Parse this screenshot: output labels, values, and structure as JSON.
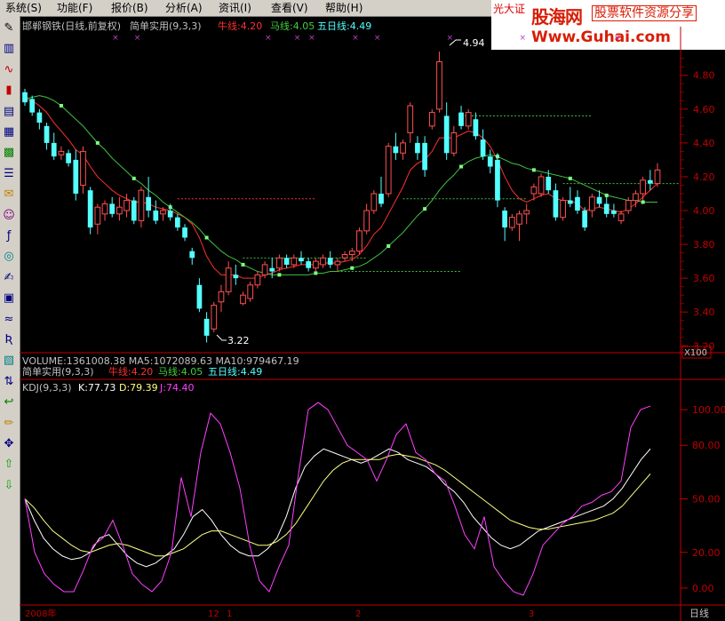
{
  "menu": [
    "系统(S)",
    "功能(F)",
    "报价(B)",
    "分析(A)",
    "资讯(I)",
    "查看(V)",
    "帮助(H)"
  ],
  "brand": {
    "broker": "光大证",
    "main": "股海网",
    "sub": "股票软件资源分享",
    "url": "Www.Guhai.com"
  },
  "toolbar_icons": [
    "drawing-icon",
    "bar-chart-icon",
    "line-chart-icon",
    "candlestick-icon",
    "report-icon",
    "table-icon",
    "grid-icon",
    "stock-list-icon",
    "mail-icon",
    "people-icon",
    "formula-icon",
    "news-icon",
    "notes-icon",
    "text-f10-icon",
    "indicator-icon",
    "rsi-icon",
    "system-icon",
    "sort-icon",
    "back-icon",
    "pencil-icon",
    "move-icon",
    "up-arrow-icon",
    "down-arrow-icon"
  ],
  "main_header": {
    "title": "邯郸钢铁(日线,前复权)",
    "indicator": "简单实用(9,3,3)",
    "niu": "牛线:4.20",
    "ma": "马线:4.05",
    "wu": "五日线:4.49"
  },
  "volume_header": "VOLUME:1361008.38  MA5:1072089.63  MA10:979467.19",
  "sub_header": {
    "indicator": "简单实用(9,3,3)",
    "niu": "牛线:4.20",
    "ma": "马线:4.05",
    "wu": "五日线:4.49"
  },
  "kdj_header": {
    "name": "KDJ(9,3,3)",
    "k": "K:77.73",
    "d": "D:79.39",
    "j": "J:74.40"
  },
  "annotations": {
    "high": "4.94",
    "low": "3.22"
  },
  "axis_badge": "X100",
  "period_label": "日线",
  "date_labels": [
    "2008年",
    "12",
    "1",
    "2",
    "3"
  ],
  "colors": {
    "up": "#ff5050",
    "down": "#54ffff",
    "niu": "#ff3030",
    "ma": "#40c040",
    "five": "#ffffff",
    "k": "#ffffff",
    "d": "#ffff80",
    "j": "#ff40ff",
    "grid": "#800000"
  },
  "chart_data": [
    {
      "type": "candlestick",
      "title": "邯郸钢铁(日线,前复权)",
      "y_ticks": [
        "4.80",
        "4.60",
        "4.40",
        "4.20",
        "4.00",
        "3.80",
        "3.60",
        "3.40",
        "3.20"
      ],
      "ylim": [
        3.17,
        4.93
      ],
      "candles": [
        [
          4.7,
          4.72,
          4.62,
          4.64
        ],
        [
          4.66,
          4.68,
          4.56,
          4.58
        ],
        [
          4.58,
          4.6,
          4.48,
          4.52
        ],
        [
          4.5,
          4.52,
          4.36,
          4.4
        ],
        [
          4.4,
          4.46,
          4.3,
          4.32
        ],
        [
          4.33,
          4.38,
          4.3,
          4.35
        ],
        [
          4.34,
          4.36,
          4.26,
          4.28
        ],
        [
          4.3,
          4.36,
          4.06,
          4.1
        ],
        [
          4.15,
          4.38,
          4.1,
          4.35
        ],
        [
          4.12,
          4.14,
          3.86,
          3.9
        ],
        [
          3.92,
          4.04,
          3.86,
          4.02
        ],
        [
          3.98,
          4.06,
          3.94,
          4.04
        ],
        [
          4.04,
          4.08,
          3.96,
          3.98
        ],
        [
          3.98,
          4.08,
          3.94,
          4.02
        ],
        [
          4.0,
          4.1,
          3.96,
          4.06
        ],
        [
          4.06,
          4.08,
          3.92,
          3.94
        ],
        [
          3.94,
          4.14,
          3.9,
          4.12
        ],
        [
          4.08,
          4.2,
          3.96,
          4.0
        ],
        [
          4.0,
          4.06,
          3.92,
          3.94
        ],
        [
          3.98,
          4.02,
          3.94,
          4.0
        ],
        [
          4.0,
          4.04,
          3.94,
          3.96
        ],
        [
          3.96,
          3.98,
          3.88,
          3.9
        ],
        [
          3.9,
          3.92,
          3.82,
          3.84
        ],
        [
          3.76,
          3.78,
          3.68,
          3.72
        ],
        [
          3.56,
          3.6,
          3.4,
          3.42
        ],
        [
          3.36,
          3.4,
          3.22,
          3.26
        ],
        [
          3.3,
          3.46,
          3.28,
          3.44
        ],
        [
          3.46,
          3.56,
          3.4,
          3.52
        ],
        [
          3.52,
          3.7,
          3.5,
          3.66
        ],
        [
          3.62,
          3.68,
          3.56,
          3.6
        ],
        [
          3.45,
          3.52,
          3.44,
          3.5
        ],
        [
          3.48,
          3.58,
          3.46,
          3.56
        ],
        [
          3.56,
          3.64,
          3.54,
          3.62
        ],
        [
          3.62,
          3.7,
          3.6,
          3.68
        ],
        [
          3.66,
          3.72,
          3.6,
          3.64
        ],
        [
          3.66,
          3.74,
          3.64,
          3.72
        ],
        [
          3.72,
          3.74,
          3.66,
          3.68
        ],
        [
          3.68,
          3.74,
          3.66,
          3.72
        ],
        [
          3.72,
          3.76,
          3.68,
          3.7
        ],
        [
          3.7,
          3.72,
          3.64,
          3.66
        ],
        [
          3.66,
          3.72,
          3.64,
          3.7
        ],
        [
          3.68,
          3.74,
          3.66,
          3.72
        ],
        [
          3.72,
          3.76,
          3.66,
          3.68
        ],
        [
          3.68,
          3.72,
          3.64,
          3.7
        ],
        [
          3.72,
          3.76,
          3.7,
          3.74
        ],
        [
          3.74,
          3.78,
          3.7,
          3.76
        ],
        [
          3.76,
          3.9,
          3.74,
          3.88
        ],
        [
          3.88,
          4.04,
          3.86,
          4.0
        ],
        [
          4.0,
          4.12,
          3.98,
          4.1
        ],
        [
          4.1,
          4.2,
          4.02,
          4.04
        ],
        [
          4.1,
          4.4,
          4.08,
          4.38
        ],
        [
          4.38,
          4.46,
          4.3,
          4.34
        ],
        [
          4.34,
          4.42,
          4.3,
          4.4
        ],
        [
          4.46,
          4.64,
          4.4,
          4.62
        ],
        [
          4.4,
          4.44,
          4.3,
          4.34
        ],
        [
          4.4,
          4.44,
          4.2,
          4.24
        ],
        [
          4.5,
          4.6,
          4.48,
          4.58
        ],
        [
          4.6,
          4.94,
          4.58,
          4.88
        ],
        [
          4.56,
          4.64,
          4.3,
          4.34
        ],
        [
          4.34,
          4.5,
          4.32,
          4.46
        ],
        [
          4.58,
          4.62,
          4.48,
          4.5
        ],
        [
          4.5,
          4.6,
          4.48,
          4.58
        ],
        [
          4.54,
          4.58,
          4.42,
          4.44
        ],
        [
          4.42,
          4.48,
          4.3,
          4.32
        ],
        [
          4.32,
          4.36,
          4.22,
          4.26
        ],
        [
          4.3,
          4.34,
          4.02,
          4.06
        ],
        [
          4.0,
          4.02,
          3.82,
          3.9
        ],
        [
          3.9,
          3.98,
          3.88,
          3.96
        ],
        [
          3.92,
          4.0,
          3.82,
          3.98
        ],
        [
          3.98,
          4.04,
          3.92,
          4.0
        ],
        [
          4.1,
          4.16,
          4.06,
          4.14
        ],
        [
          4.1,
          4.22,
          4.08,
          4.2
        ],
        [
          4.2,
          4.24,
          4.1,
          4.12
        ],
        [
          4.12,
          4.16,
          3.94,
          3.96
        ],
        [
          3.96,
          4.08,
          3.94,
          4.06
        ],
        [
          4.06,
          4.14,
          4.02,
          4.04
        ],
        [
          4.08,
          4.12,
          3.98,
          4.0
        ],
        [
          4.0,
          4.02,
          3.88,
          3.9
        ],
        [
          4.0,
          4.1,
          3.96,
          4.08
        ],
        [
          4.08,
          4.12,
          4.02,
          4.04
        ],
        [
          4.04,
          4.08,
          3.96,
          3.98
        ],
        [
          4.0,
          4.04,
          3.96,
          3.98
        ],
        [
          3.94,
          4.0,
          3.92,
          3.98
        ],
        [
          4.0,
          4.08,
          3.98,
          4.06
        ],
        [
          4.06,
          4.12,
          4.02,
          4.1
        ],
        [
          4.1,
          4.2,
          4.06,
          4.18
        ],
        [
          4.18,
          4.24,
          4.12,
          4.16
        ],
        [
          4.16,
          4.28,
          4.14,
          4.24
        ]
      ],
      "series": [
        {
          "name": "牛线",
          "values": [
            4.66,
            4.65,
            4.62,
            4.58,
            4.52,
            4.47,
            4.42,
            4.36,
            4.33,
            4.26,
            4.2,
            4.16,
            4.12,
            4.09,
            4.07,
            4.05,
            4.05,
            4.04,
            4.02,
            4.01,
            4.0,
            3.98,
            3.96,
            3.92,
            3.84,
            3.73,
            3.66,
            3.62,
            3.62,
            3.62,
            3.6,
            3.6,
            3.6,
            3.62,
            3.63,
            3.65,
            3.66,
            3.67,
            3.68,
            3.68,
            3.68,
            3.69,
            3.69,
            3.69,
            3.7,
            3.71,
            3.74,
            3.79,
            3.86,
            3.9,
            3.98,
            4.06,
            4.14,
            4.24,
            4.28,
            4.3,
            4.35,
            4.43,
            4.43,
            4.43,
            4.45,
            4.47,
            4.46,
            4.43,
            4.38,
            4.3,
            4.2,
            4.12,
            4.07,
            4.05,
            4.07,
            4.09,
            4.1,
            4.07,
            4.06,
            4.06,
            4.04,
            4.0,
            4.01,
            4.02,
            4.01,
            4.0,
            3.99,
            4.01,
            4.04,
            4.08,
            4.12,
            4.16
          ]
        },
        {
          "name": "马线",
          "values": [
            4.66,
            4.67,
            4.68,
            4.67,
            4.65,
            4.62,
            4.58,
            4.54,
            4.5,
            4.45,
            4.4,
            4.36,
            4.31,
            4.27,
            4.23,
            4.19,
            4.16,
            4.12,
            4.09,
            4.05,
            4.02,
            3.99,
            3.96,
            3.93,
            3.89,
            3.84,
            3.8,
            3.76,
            3.73,
            3.71,
            3.68,
            3.66,
            3.64,
            3.63,
            3.62,
            3.62,
            3.62,
            3.62,
            3.62,
            3.62,
            3.63,
            3.63,
            3.64,
            3.64,
            3.65,
            3.66,
            3.67,
            3.69,
            3.72,
            3.75,
            3.79,
            3.83,
            3.87,
            3.92,
            3.97,
            4.01,
            4.06,
            4.12,
            4.17,
            4.21,
            4.26,
            4.29,
            4.31,
            4.32,
            4.33,
            4.32,
            4.3,
            4.28,
            4.27,
            4.25,
            4.24,
            4.23,
            4.22,
            4.21,
            4.2,
            4.19,
            4.17,
            4.15,
            4.13,
            4.11,
            4.09,
            4.08,
            4.07,
            4.06,
            4.06,
            4.05,
            4.05,
            4.05
          ]
        }
      ],
      "segments": [
        [
          21,
          40,
          4.07
        ],
        [
          30,
          47,
          3.72
        ],
        [
          42,
          60,
          3.64
        ],
        [
          52,
          69,
          4.07
        ],
        [
          60,
          78,
          4.56
        ],
        [
          74,
          90,
          4.16
        ]
      ],
      "highlight_points": [
        [
          0,
          4.2
        ],
        [
          10,
          4.2
        ],
        [
          21,
          4.07
        ],
        [
          30,
          3.72
        ],
        [
          42,
          3.64
        ],
        [
          52,
          4.07
        ],
        [
          60,
          4.56
        ],
        [
          69,
          4.07
        ],
        [
          74,
          4.16
        ]
      ],
      "annotations": [
        {
          "text": "4.94",
          "x": 57,
          "y": 4.94
        },
        {
          "text": "3.22",
          "x": 25,
          "y": 3.22
        }
      ]
    },
    {
      "type": "line",
      "title": "KDJ(9,3,3)",
      "y_ticks": [
        "100.00",
        "80.00",
        "50.00",
        "20.00",
        "0.00"
      ],
      "ylim": [
        -8,
        108
      ],
      "series": [
        {
          "name": "K",
          "values": [
            50,
            38,
            28,
            22,
            18,
            16,
            17,
            20,
            28,
            30,
            24,
            18,
            14,
            12,
            14,
            18,
            22,
            30,
            40,
            44,
            38,
            30,
            24,
            20,
            18,
            18,
            22,
            28,
            40,
            56,
            68,
            74,
            78,
            76,
            74,
            72,
            70,
            72,
            75,
            78,
            76,
            72,
            70,
            68,
            64,
            58,
            54,
            48,
            40,
            34,
            28,
            24,
            22,
            24,
            28,
            32,
            34,
            36,
            38,
            40,
            42,
            44,
            46,
            50,
            56,
            64,
            72,
            78
          ]
        },
        {
          "name": "D",
          "values": [
            50,
            45,
            38,
            32,
            28,
            24,
            21,
            20,
            22,
            24,
            25,
            24,
            22,
            20,
            18,
            18,
            20,
            22,
            26,
            30,
            32,
            32,
            30,
            28,
            26,
            24,
            24,
            26,
            30,
            36,
            44,
            52,
            60,
            66,
            70,
            72,
            72,
            72,
            72,
            74,
            75,
            74,
            73,
            71,
            69,
            66,
            62,
            58,
            54,
            50,
            46,
            42,
            38,
            36,
            34,
            33,
            33,
            34,
            35,
            36,
            37,
            38,
            40,
            42,
            46,
            52,
            58,
            64
          ]
        },
        {
          "name": "J",
          "values": [
            50,
            20,
            8,
            2,
            -2,
            -2,
            10,
            24,
            28,
            38,
            24,
            8,
            2,
            -2,
            4,
            20,
            62,
            40,
            76,
            98,
            92,
            76,
            56,
            24,
            4,
            -2,
            12,
            24,
            64,
            100,
            104,
            100,
            90,
            80,
            76,
            72,
            60,
            72,
            86,
            92,
            76,
            72,
            64,
            60,
            46,
            30,
            22,
            40,
            12,
            4,
            -2,
            -4,
            8,
            24,
            30,
            36,
            40,
            46,
            48,
            52,
            54,
            60,
            90,
            100,
            102
          ]
        }
      ]
    }
  ]
}
